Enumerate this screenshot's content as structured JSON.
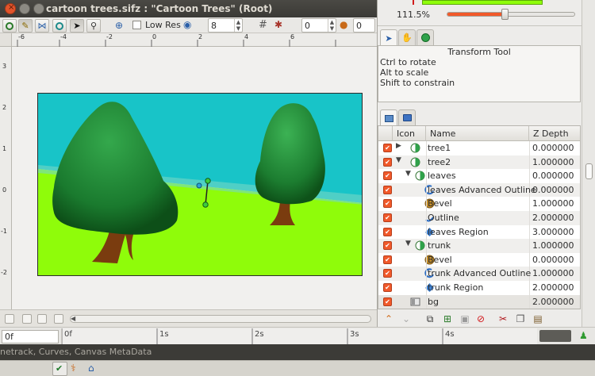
{
  "window": {
    "title": "cartoon trees.sifz : \"Cartoon Trees\" (Root)"
  },
  "toolbar": {
    "low_res_label": "Low Res",
    "spin1_value": "8",
    "spin2_value": "0",
    "spin3_value": "0"
  },
  "navigator": {
    "zoom_label": "111.5%",
    "zoom_fraction": 0.45
  },
  "tool_options": {
    "title": "Transform Tool",
    "hints": [
      "Ctrl to rotate",
      "Alt to scale",
      "Shift to constrain"
    ]
  },
  "layers_panel": {
    "columns": [
      "Icon",
      "Name",
      "Z Depth"
    ],
    "rows": [
      {
        "name": "tree1",
        "z": "0.000000",
        "indent": 0,
        "expander": "▶",
        "icon": "group-icon"
      },
      {
        "name": "tree2",
        "z": "1.000000",
        "indent": 0,
        "expander": "▼",
        "icon": "group-icon"
      },
      {
        "name": "leaves",
        "z": "0.000000",
        "indent": 1,
        "expander": "▼",
        "icon": "group-icon"
      },
      {
        "name": "leaves Advanced Outline",
        "z": "0.000000",
        "indent": 2,
        "expander": "",
        "icon": "advanced-outline-icon"
      },
      {
        "name": "Bevel",
        "z": "1.000000",
        "indent": 2,
        "expander": "",
        "icon": "bevel-icon"
      },
      {
        "name": "Outline",
        "z": "2.000000",
        "indent": 2,
        "expander": "",
        "icon": "outline-icon"
      },
      {
        "name": "leaves Region",
        "z": "3.000000",
        "indent": 2,
        "expander": "",
        "icon": "region-icon"
      },
      {
        "name": "trunk",
        "z": "1.000000",
        "indent": 1,
        "expander": "▼",
        "icon": "group-icon"
      },
      {
        "name": "Bevel",
        "z": "0.000000",
        "indent": 2,
        "expander": "",
        "icon": "bevel-icon"
      },
      {
        "name": "trunk Advanced Outline",
        "z": "1.000000",
        "indent": 2,
        "expander": "",
        "icon": "advanced-outline-icon"
      },
      {
        "name": "trunk Region",
        "z": "2.000000",
        "indent": 2,
        "expander": "",
        "icon": "region-icon"
      },
      {
        "name": "bg",
        "z": "2.000000",
        "indent": 0,
        "expander": "",
        "icon": "rectangle-icon"
      }
    ]
  },
  "timebar": {
    "time_value": "0f",
    "ticks": [
      "0f",
      "1s",
      "2s",
      "3s",
      "4s"
    ]
  },
  "statusbar": {
    "text": "netrack, Curves, Canvas MetaData"
  },
  "ruler": {
    "h_labels": [
      "-6",
      "-4",
      "-2",
      "0",
      "2",
      "4",
      "6"
    ],
    "v_labels": [
      "3",
      "2",
      "1",
      "0",
      "-1",
      "-2"
    ]
  },
  "colors": {
    "sky": "#18c4c8",
    "grass": "#8ffc0a",
    "leaf_dark": "#0f5e1c",
    "leaf_light": "#2fa24a",
    "trunk": "#7a3c0f",
    "accent_orange": "#f1592a"
  }
}
